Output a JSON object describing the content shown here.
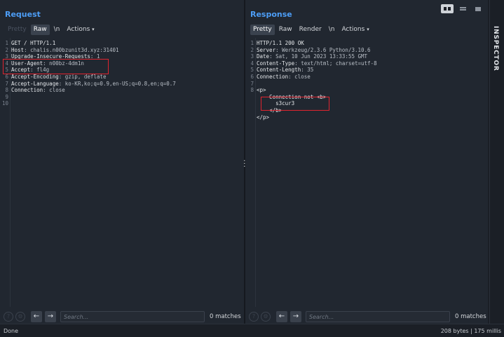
{
  "request": {
    "title": "Request",
    "tabs": [
      {
        "label": "Pretty",
        "state": "disabled"
      },
      {
        "label": "Raw",
        "state": "active"
      },
      {
        "label": "\\n",
        "state": "normal"
      },
      {
        "label": "Actions",
        "state": "normal",
        "icon": "chevron-down-icon"
      }
    ],
    "lines": [
      {
        "n": "1",
        "key": "GET / HTTP/1.1",
        "val": ""
      },
      {
        "n": "2",
        "key": "Host",
        "val": ": chalis.n00bzunit3d.xyz:31401"
      },
      {
        "n": "3",
        "key": "Upgrade-Insecure-Requests",
        "val": ": 1"
      },
      {
        "n": "4",
        "key": "User-Agent",
        "val": ": n00bz-4dm1n"
      },
      {
        "n": "5",
        "key": "Accept",
        "val": ": fl4g"
      },
      {
        "n": "6",
        "key": "Accept-Encoding",
        "val": ": gzip, deflate"
      },
      {
        "n": "7",
        "key": "Accept-Language",
        "val": ": ko-KR,ko;q=0.9,en-US;q=0.8,en;q=0.7"
      },
      {
        "n": "8",
        "key": "Connection",
        "val": ": close"
      },
      {
        "n": "9",
        "key": "",
        "val": ""
      },
      {
        "n": "10",
        "key": "",
        "val": ""
      }
    ],
    "search_placeholder": "Search...",
    "matches": "0 matches"
  },
  "response": {
    "title": "Response",
    "tabs": [
      {
        "label": "Pretty",
        "state": "active"
      },
      {
        "label": "Raw",
        "state": "normal"
      },
      {
        "label": "Render",
        "state": "normal"
      },
      {
        "label": "\\n",
        "state": "normal"
      },
      {
        "label": "Actions",
        "state": "normal",
        "icon": "chevron-down-icon"
      }
    ],
    "lines": [
      {
        "n": "1",
        "key": "HTTP/1.1 200 OK",
        "val": ""
      },
      {
        "n": "2",
        "key": "Server",
        "val": ": Werkzeug/2.3.6 Python/3.10.6"
      },
      {
        "n": "3",
        "key": "Date",
        "val": ": Sat, 10 Jun 2023 13:33:55 GMT"
      },
      {
        "n": "4",
        "key": "Content-Type",
        "val": ": text/html; charset=utf-8"
      },
      {
        "n": "5",
        "key": "Content-Length",
        "val": ": 35"
      },
      {
        "n": "6",
        "key": "Connection",
        "val": ": close"
      },
      {
        "n": "7",
        "key": "",
        "val": ""
      },
      {
        "n": "8",
        "key": "<p>",
        "val": ""
      },
      {
        "n": "",
        "key": "    Connection not <b>",
        "val": ""
      },
      {
        "n": "",
        "key": "      s3cur3",
        "val": ""
      },
      {
        "n": "",
        "key": "    </b>",
        "val": ""
      },
      {
        "n": "",
        "key": "</p>",
        "val": ""
      }
    ],
    "search_placeholder": "Search...",
    "matches": "0 matches"
  },
  "inspector": {
    "label": "INSPECTOR"
  },
  "status": {
    "left": "Done",
    "right": "208 bytes | 175 millis"
  },
  "colors": {
    "accent": "#4d9ef7",
    "highlight_box": "#e0242f",
    "background": "#212730"
  }
}
